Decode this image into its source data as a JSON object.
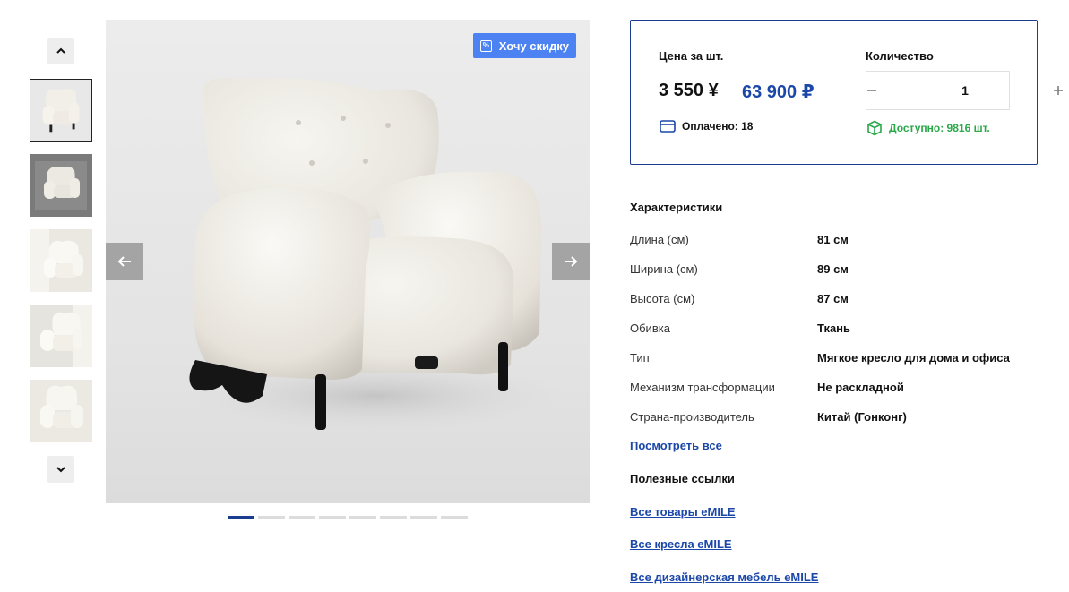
{
  "gallery": {
    "discount_button": "Хочу скидку",
    "thumbnail_count": 5,
    "active_thumbnail": 1,
    "slide_count": 8,
    "active_slide": 1
  },
  "price": {
    "unit_label": "Цена за шт.",
    "unit_price": "3 550 ¥",
    "total_price": "63 900 ₽",
    "paid_text": "Оплачено: 18",
    "quantity_label": "Количество",
    "quantity_value": "1",
    "available_text": "Доступно: 9816 шт."
  },
  "specs": {
    "title": "Характеристики",
    "rows": [
      {
        "label": "Длина (см)",
        "value": "81 см"
      },
      {
        "label": "Ширина (см)",
        "value": "89 см"
      },
      {
        "label": "Высота (см)",
        "value": "87 см"
      },
      {
        "label": "Обивка",
        "value": "Ткань"
      },
      {
        "label": "Тип",
        "value": "Мягкое кресло для дома и офиса"
      },
      {
        "label": "Механизм трансформации",
        "value": "Не раскладной"
      },
      {
        "label": "Страна-производитель",
        "value": "Китай (Гонконг)"
      }
    ],
    "see_all": "Посмотреть все"
  },
  "links": {
    "title": "Полезные ссылки",
    "items": [
      "Все товары eMILE",
      "Все кресла eMILE",
      "Все дизайнерская мебель eMILE"
    ]
  },
  "colors": {
    "accent_blue": "#1a47a8",
    "discount_blue": "#4d82f3",
    "available_green": "#2aa84a"
  }
}
